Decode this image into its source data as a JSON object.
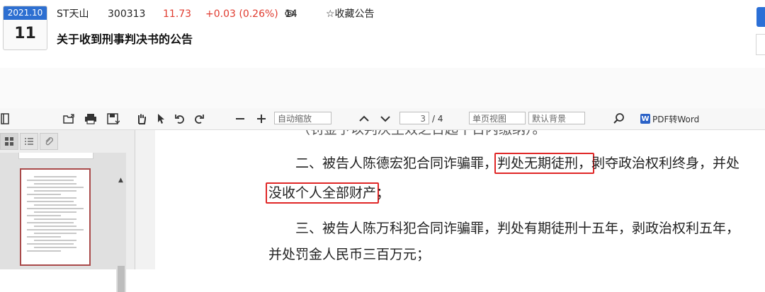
{
  "announcement": {
    "date_ym": "2021.10",
    "date_day": "11",
    "stock_name": "ST天山",
    "stock_code": "300313",
    "price": "11.73",
    "change": "+0.03 (0.26%)",
    "views": "14",
    "favorite_label": "☆收藏公告",
    "title": "关于收到刑事判决书的公告",
    "price_color": "#e03b2f"
  },
  "toolbar": {
    "zoom_value": "自动缩放",
    "page_current": "3",
    "page_total": "/ 4",
    "view_mode": "单页视图",
    "background": "默认背景",
    "pdf_to_word_label": "PDF转Word",
    "icons": [
      "sidebar-toggle-icon",
      "export-icon",
      "print-icon",
      "save-icon",
      "hand-tool-icon",
      "pointer-tool-icon",
      "rotate-ccw-icon",
      "rotate-cw-icon",
      "zoom-out-icon",
      "zoom-in-icon",
      "prev-page-icon",
      "next-page-icon",
      "search-icon",
      "word-icon"
    ]
  },
  "sidebar": {
    "tabs": [
      "thumbnails-icon",
      "outline-icon",
      "attachments-icon"
    ]
  },
  "document": {
    "clipped_line": "（罚金予以判决生效之日起十日内缴纳）。",
    "p1_pre": "二、被告人陈德宏犯合同诈骗罪，",
    "p1_hl": "判处无期徒刑，",
    "p1_post": "剥夺政治权利终身，并处",
    "p2_hl": "没收个人全部财产",
    "p2_post": "；",
    "p3": "三、被告人陈万科犯合同诈骗罪，判处有期徒刑十五年，剥政治权利五年，",
    "p4": "并处罚金人民币三百万元；",
    "highlight_color": "#e02727"
  }
}
